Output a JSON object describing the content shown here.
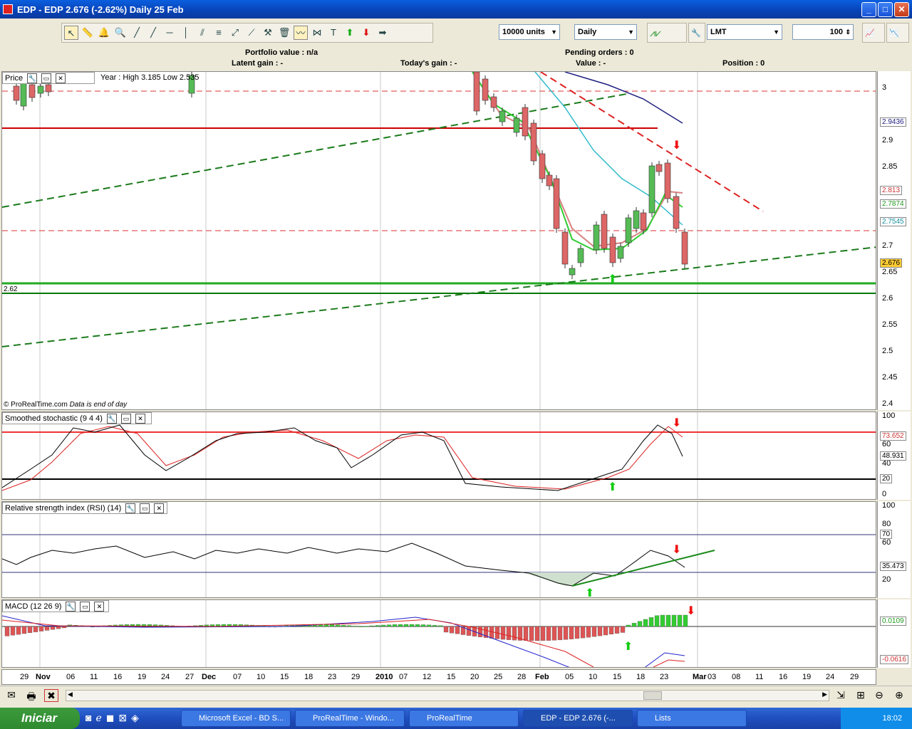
{
  "window": {
    "title": "EDP - EDP    2.676 (-2.62%)    Daily  25 Feb",
    "buttons": [
      "_",
      "□",
      "✕"
    ]
  },
  "toolbar": {
    "units_select": "10000 units",
    "period_select": "Daily",
    "order_type_select": "LMT",
    "quantity_value": "100"
  },
  "infobar": {
    "portfolio_value": "Portfolio value : n/a",
    "latent_gain": "Latent gain : -",
    "todays_gain": "Today's gain : -",
    "pending_orders": "Pending orders : 0",
    "value": "Value : -",
    "position": "Position : 0"
  },
  "price_panel": {
    "label": "Price",
    "year_info": "Year : High 3.185 Low 2.535",
    "copyright": "© ProRealTime.com",
    "data_note": "Data is end of day",
    "level_label": "2.62",
    "ticks": [
      "3",
      "2.9",
      "2.85",
      "2.7",
      "2.65",
      "2.6",
      "2.55",
      "2.5",
      "2.45",
      "2.4"
    ],
    "tags": {
      "ma_blue": "2.9436",
      "ma_red": "2.813",
      "ma_green": "2.7874",
      "ma_cyan": "2.7545",
      "last": "2.676"
    },
    "colors": {
      "last_tag": "#ffcc33",
      "ma_red": "#d88080",
      "ma_green": "#33cc33",
      "ma_cyan": "#33bbcc",
      "ma_blue": "#202080"
    }
  },
  "stoch_panel": {
    "label": "Smoothed stochastic (9 4 4)",
    "ticks": [
      "100",
      "60",
      "40",
      "0"
    ],
    "tags": {
      "overbought_line": "73.652",
      "value": "48.931",
      "level20": "20"
    }
  },
  "rsi_panel": {
    "label": "Relative strength index (RSI) (14)",
    "ticks": [
      "100",
      "80",
      "60",
      "20"
    ],
    "tags": {
      "level70": "70",
      "value": "35.473"
    }
  },
  "macd_panel": {
    "label": "MACD (12 26 9)",
    "tags": {
      "value": "0.0109",
      "signal": "-0.0616"
    }
  },
  "xaxis": {
    "labels": [
      "29",
      "Nov",
      "06",
      "11",
      "16",
      "19",
      "24",
      "27",
      "Dec",
      "07",
      "10",
      "15",
      "18",
      "23",
      "29",
      "2010",
      "07",
      "12",
      "15",
      "20",
      "25",
      "28",
      "Feb",
      "05",
      "10",
      "15",
      "18",
      "23",
      "Mar",
      "03",
      "08",
      "11",
      "16",
      "19",
      "24",
      "29"
    ]
  },
  "taskbar": {
    "start": "Iniciar",
    "tasks": [
      "Microsoft Excel - BD S...",
      "ProRealTime - Windo...",
      "ProRealTime",
      "EDP - EDP    2.676 (-...",
      "Lists"
    ],
    "clock": "18:02"
  }
}
